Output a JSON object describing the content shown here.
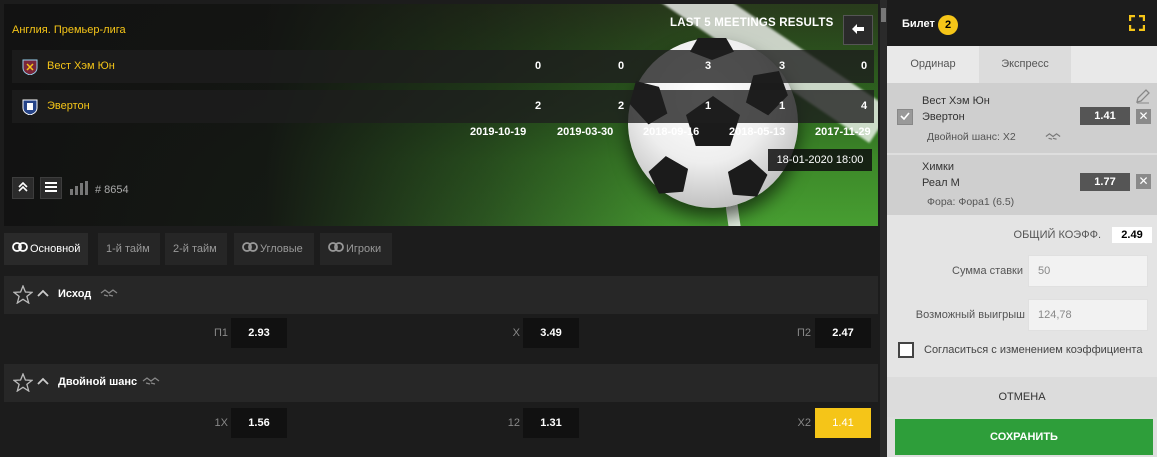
{
  "match": {
    "league": "Англия. Премьер-лига",
    "last5_title": "LAST 5 MEETINGS RESULTS",
    "back_icon": "arrow-left-icon",
    "teams": [
      {
        "name": "Вест Хэм Юн",
        "crest_color": "#7a263a",
        "scores": [
          "0",
          "0",
          "3",
          "3",
          "0"
        ]
      },
      {
        "name": "Эвертон",
        "crest_color": "#274488",
        "scores": [
          "2",
          "2",
          "1",
          "1",
          "4"
        ]
      }
    ],
    "dates": [
      "2019-10-19",
      "2019-03-30",
      "2018-09-16",
      "2018-05-13",
      "2017-11-29"
    ],
    "kickoff": "18-01-2020  18:00",
    "match_id": "# 8654"
  },
  "tabs": [
    {
      "label": "Основной",
      "icon": "link-icon",
      "active": true
    },
    {
      "label": "1-й тайм",
      "active": false
    },
    {
      "label": "2-й тайм",
      "active": false
    },
    {
      "label": "Угловые",
      "icon": "link-icon",
      "active": false
    },
    {
      "label": "Игроки",
      "icon": "link-icon",
      "active": false
    }
  ],
  "markets": [
    {
      "title": "Исход",
      "odds": [
        {
          "label": "П1",
          "value": "2.93",
          "selected": false
        },
        {
          "label": "X",
          "value": "3.49",
          "selected": false
        },
        {
          "label": "П2",
          "value": "2.47",
          "selected": false
        }
      ]
    },
    {
      "title": "Двойной шанс",
      "odds": [
        {
          "label": "1X",
          "value": "1.56",
          "selected": false
        },
        {
          "label": "12",
          "value": "1.31",
          "selected": false
        },
        {
          "label": "X2",
          "value": "1.41",
          "selected": true
        }
      ]
    }
  ],
  "slip": {
    "title": "Билет",
    "count": "2",
    "tabs": [
      "Ординар",
      "Экспресс"
    ],
    "bets": [
      {
        "home": "Вест Хэм Юн",
        "away": "Эвертон",
        "market": "Двойной шанс: X2",
        "odd": "1.41"
      },
      {
        "home": "Химки",
        "away": "Реал М",
        "market": "Фора: Фора1 (6.5)",
        "odd": "1.77"
      }
    ],
    "total_label": "ОБЩИЙ КОЭФФ.",
    "total_value": "2.49",
    "stake_label": "Сумма ставки",
    "stake_value": "50",
    "win_label": "Возможный выигрыш",
    "win_value": "124,78",
    "agree_label": "Согласиться с изменением коэффициента",
    "cancel_label": "ОТМЕНА",
    "save_label": "СОХРАНИТЬ"
  },
  "colors": {
    "accent": "#f5c518",
    "save": "#2e9e3a",
    "dark": "#1c1c1c"
  }
}
